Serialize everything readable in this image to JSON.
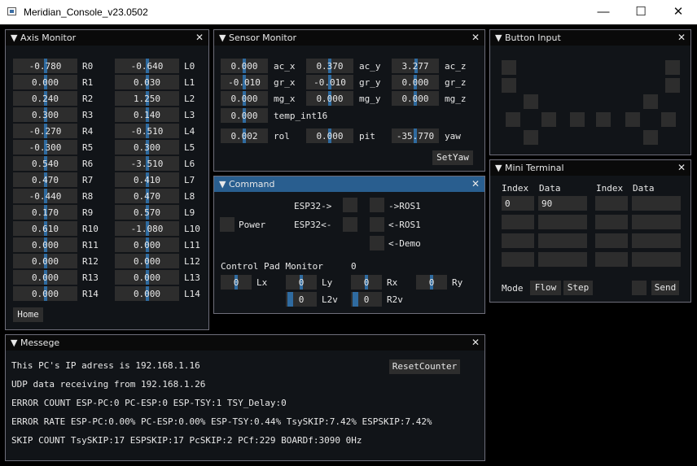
{
  "app": {
    "title": "Meridian_Console_v23.0502"
  },
  "window_controls": {
    "minimize": "—",
    "maximize": "☐",
    "close": "✕"
  },
  "axis_monitor": {
    "title": "▼ Axis Monitor",
    "rows": [
      {
        "r_val": "-0.780",
        "r_lbl": "R0",
        "l_val": "-0.640",
        "l_lbl": "L0"
      },
      {
        "r_val": "0.000",
        "r_lbl": "R1",
        "l_val": "0.030",
        "l_lbl": "L1"
      },
      {
        "r_val": "0.240",
        "r_lbl": "R2",
        "l_val": "1.250",
        "l_lbl": "L2"
      },
      {
        "r_val": "0.300",
        "r_lbl": "R3",
        "l_val": "0.140",
        "l_lbl": "L3"
      },
      {
        "r_val": "-0.270",
        "r_lbl": "R4",
        "l_val": "-0.510",
        "l_lbl": "L4"
      },
      {
        "r_val": "-0.300",
        "r_lbl": "R5",
        "l_val": "0.300",
        "l_lbl": "L5"
      },
      {
        "r_val": "0.540",
        "r_lbl": "R6",
        "l_val": "-3.510",
        "l_lbl": "L6"
      },
      {
        "r_val": "0.470",
        "r_lbl": "R7",
        "l_val": "0.410",
        "l_lbl": "L7"
      },
      {
        "r_val": "-0.440",
        "r_lbl": "R8",
        "l_val": "0.470",
        "l_lbl": "L8"
      },
      {
        "r_val": "0.170",
        "r_lbl": "R9",
        "l_val": "0.570",
        "l_lbl": "L9"
      },
      {
        "r_val": "0.610",
        "r_lbl": "R10",
        "l_val": "-1.080",
        "l_lbl": "L10"
      },
      {
        "r_val": "0.000",
        "r_lbl": "R11",
        "l_val": "0.000",
        "l_lbl": "L11"
      },
      {
        "r_val": "0.000",
        "r_lbl": "R12",
        "l_val": "0.000",
        "l_lbl": "L12"
      },
      {
        "r_val": "0.000",
        "r_lbl": "R13",
        "l_val": "0.000",
        "l_lbl": "L13"
      },
      {
        "r_val": "0.000",
        "r_lbl": "R14",
        "l_val": "0.000",
        "l_lbl": "L14"
      }
    ],
    "home_label": "Home"
  },
  "sensor_monitor": {
    "title": "▼ Sensor Monitor",
    "ac_x": "0.000",
    "ac_x_lbl": "ac_x",
    "ac_y": "0.370",
    "ac_y_lbl": "ac_y",
    "ac_z": "3.277",
    "ac_z_lbl": "ac_z",
    "gr_x": "-0.010",
    "gr_x_lbl": "gr_x",
    "gr_y": "-0.010",
    "gr_y_lbl": "gr_y",
    "gr_z": "0.000",
    "gr_z_lbl": "gr_z",
    "mg_x": "0.000",
    "mg_x_lbl": "mg_x",
    "mg_y": "0.000",
    "mg_y_lbl": "mg_y",
    "mg_z": "0.000",
    "mg_z_lbl": "mg_z",
    "temp": "0.000",
    "temp_lbl": "temp_int16",
    "rol": "0.002",
    "rol_lbl": "rol",
    "pit": "0.000",
    "pit_lbl": "pit",
    "yaw": "-35.770",
    "yaw_lbl": "yaw",
    "setyaw_label": "SetYaw"
  },
  "button_input": {
    "title": "▼ Button Input"
  },
  "command": {
    "title": "▼ Command",
    "power_label": "Power",
    "esp32_out": "ESP32->",
    "esp32_in": "ESP32<-",
    "to_ros1": "->ROS1",
    "from_ros1": "<-ROS1",
    "from_demo": "<-Demo",
    "pad_monitor_label": "Control Pad Monitor",
    "pad_monitor_value": "0",
    "lx": "0",
    "lx_lbl": "Lx",
    "ly": "0",
    "ly_lbl": "Ly",
    "rx": "0",
    "rx_lbl": "Rx",
    "ry": "0",
    "ry_lbl": "Ry",
    "l2v": "0",
    "l2v_lbl": "L2v",
    "r2v": "0",
    "r2v_lbl": "R2v"
  },
  "mini_terminal": {
    "title": "▼ Mini Terminal",
    "headers": [
      "Index",
      "Data",
      "Index",
      "Data"
    ],
    "rows": [
      [
        "0",
        "90",
        "",
        ""
      ],
      [
        "",
        "",
        "",
        ""
      ],
      [
        "",
        "",
        "",
        ""
      ],
      [
        "",
        "",
        "",
        ""
      ]
    ],
    "mode_label": "Mode",
    "flow_label": "Flow",
    "step_label": "Step",
    "send_label": "Send"
  },
  "message": {
    "title": "▼ Messege",
    "reset_label": "ResetCounter",
    "lines": [
      "This PC's IP adress is 192.168.1.16",
      "UDP data receiving from 192.168.1.26",
      "ERROR COUNT ESP-PC:0 PC-ESP:0 ESP-TSY:1 TSY_Delay:0",
      "ERROR RATE ESP-PC:0.00% PC-ESP:0.00% ESP-TSY:0.44% TsySKIP:7.42% ESPSKIP:7.42%",
      "SKIP COUNT TsySKIP:17 ESPSKIP:17 PcSKIP:2 PCf:229 BOARDf:3090 0Hz"
    ]
  },
  "panel_close": "✕",
  "colors": {
    "accent": "#2f6ba0",
    "active_header": "#295e8f",
    "field": "#2d2d2d",
    "panel": "#111418"
  }
}
